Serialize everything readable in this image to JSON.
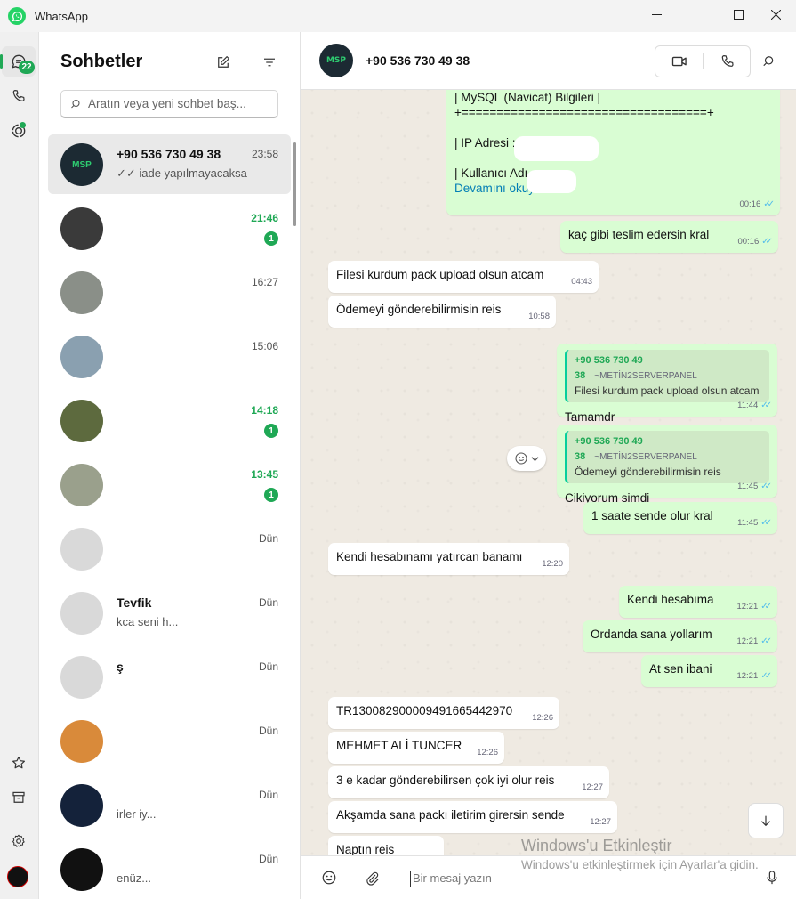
{
  "window": {
    "title": "WhatsApp",
    "controls": {
      "minimize": "—",
      "maximize": "☐",
      "close": "✕"
    }
  },
  "rail": {
    "chats_badge": "22",
    "icons": [
      "chats-icon",
      "calls-icon",
      "status-icon",
      "starred-icon",
      "archive-icon",
      "settings-icon"
    ]
  },
  "chat_list": {
    "title": "Sohbetler",
    "search_placeholder": "Aratın veya yeni sohbet baş...",
    "chats": [
      {
        "name": "+90 536 730 49 38",
        "preview": "✓✓ iade yapılmayacaksa",
        "time": "23:58",
        "unread": "",
        "time_unread": false,
        "selected": true,
        "avatar_color": "#1c2a33"
      },
      {
        "name": "",
        "preview": "",
        "time": "21:46",
        "unread": "1",
        "time_unread": true,
        "selected": false,
        "avatar_color": "#3a3a3a"
      },
      {
        "name": "",
        "preview": "",
        "time": "16:27",
        "unread": "",
        "time_unread": false,
        "selected": false,
        "avatar_color": "#8a8f88"
      },
      {
        "name": "",
        "preview": "",
        "time": "15:06",
        "unread": "",
        "time_unread": false,
        "selected": false,
        "avatar_color": "#8aa0b0"
      },
      {
        "name": "",
        "preview": "",
        "time": "14:18",
        "unread": "1",
        "time_unread": true,
        "selected": false,
        "avatar_color": "#5d6a3e"
      },
      {
        "name": "",
        "preview": "",
        "time": "13:45",
        "unread": "1",
        "time_unread": true,
        "selected": false,
        "avatar_color": "#9aa08c"
      },
      {
        "name": "",
        "preview": "",
        "time": "Dün",
        "unread": "",
        "time_unread": false,
        "selected": false,
        "avatar_color": "#d9d9d9"
      },
      {
        "name": "Tevfik",
        "preview": "kca seni h...",
        "time": "Dün",
        "unread": "",
        "time_unread": false,
        "selected": false,
        "avatar_color": "#d9d9d9"
      },
      {
        "name": "ş",
        "preview": "",
        "time": "Dün",
        "unread": "",
        "time_unread": false,
        "selected": false,
        "avatar_color": "#d9d9d9"
      },
      {
        "name": "",
        "preview": "",
        "time": "Dün",
        "unread": "",
        "time_unread": false,
        "selected": false,
        "avatar_color": "#d98a3a"
      },
      {
        "name": "",
        "preview": "irler iy...",
        "time": "Dün",
        "unread": "",
        "time_unread": false,
        "selected": false,
        "avatar_color": "#14223a"
      },
      {
        "name": "",
        "preview": "enüz...",
        "time": "Dün",
        "unread": "",
        "time_unread": false,
        "selected": false,
        "avatar_color": "#111111"
      }
    ]
  },
  "conversation": {
    "contact_name": "+90 536 730 49 38",
    "avatar_text": "MSP",
    "messages": [
      {
        "dir": "out",
        "text": "| MySQL (Navicat) Bilgileri |\n+===================================+\n\n| IP Adresi :\n\n| Kullanıcı Adı",
        "read_more": "Devamını okuyun",
        "time": "00:16"
      },
      {
        "dir": "out",
        "text": "kaç gibi teslim edersin kral",
        "time": "00:16"
      },
      {
        "dir": "in",
        "text": "Filesi kurdum pack upload olsun atcam",
        "time": "04:43"
      },
      {
        "dir": "in",
        "text": "Ödemeyi gönderebilirmisin reis",
        "time": "10:58"
      },
      {
        "dir": "out",
        "quote_name": "+90 536 730 49 38",
        "quote_tag": "~METİN2SERVERPANEL",
        "quote_text": "Filesi kurdum pack upload olsun atcam",
        "text": "Tamamdr",
        "time": "11:44"
      },
      {
        "dir": "out",
        "quote_name": "+90 536 730 49 38",
        "quote_tag": "~METİN2SERVERPANEL",
        "quote_text": "Ödemeyi gönderebilirmisin reis",
        "text": "Cikiyorum şimdi",
        "time": "11:45"
      },
      {
        "dir": "out",
        "text": "1 saate sende olur kral",
        "time": "11:45"
      },
      {
        "dir": "in",
        "text": "Kendi hesabınamı yatırcan banamı",
        "time": "12:20"
      },
      {
        "dir": "out",
        "text": "Kendi hesabıma",
        "time": "12:21"
      },
      {
        "dir": "out",
        "text": "Ordanda sana yollarım",
        "time": "12:21"
      },
      {
        "dir": "out",
        "text": "At sen ibani",
        "time": "12:21"
      },
      {
        "dir": "in",
        "text": "TR130082900009491665442970",
        "time": "12:26"
      },
      {
        "dir": "in",
        "text": "MEHMET ALİ TUNCER",
        "time": "12:26"
      },
      {
        "dir": "in",
        "text": "3 e kadar gönderebilirsen çok iyi olur reis",
        "time": "12:27"
      },
      {
        "dir": "in",
        "text": "Akşamda sana packı iletirim girersin sende",
        "time": "12:27"
      },
      {
        "dir": "in",
        "text": "Naptın reis",
        "time": ""
      }
    ],
    "composer_placeholder": "Bir mesaj yazın"
  },
  "watermark": {
    "line1": "Windows'u Etkinleştir",
    "line2": "Windows'u etkinleştirmek için Ayarlar'a gidin."
  }
}
